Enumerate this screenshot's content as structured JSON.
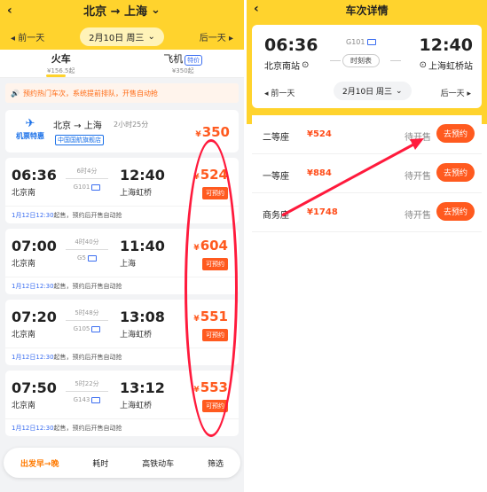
{
  "left": {
    "header": {
      "back_icon": "chevron-left-icon",
      "route": "北京 → 上海",
      "prev_day": "◂ 前一天",
      "date": "2月10日 周三",
      "next_day": "后一天 ▸"
    },
    "modes": [
      {
        "label": "火车",
        "sub": "¥156.5起"
      },
      {
        "label": "飞机",
        "sub": "¥350起",
        "badge": "特价"
      }
    ],
    "notice": "预约热门车次，系统提前排队，开售自动抢",
    "flight_card": {
      "tag": "机票特惠",
      "route": "北京 → 上海",
      "duration": "2小时25分",
      "airline": "中国国航旗舰店",
      "price": "350"
    },
    "trains": [
      {
        "dep": "06:36",
        "arr": "12:40",
        "from": "北京南",
        "to": "上海虹桥",
        "duration": "6时4分",
        "no": "G101",
        "price": "524",
        "book": "可预约",
        "sale_time": "1月12日12:30",
        "sale_text": "起售，预约后开售自动抢"
      },
      {
        "dep": "07:00",
        "arr": "11:40",
        "from": "北京南",
        "to": "上海",
        "duration": "4时40分",
        "no": "G5",
        "price": "604",
        "book": "可预约",
        "sale_time": "1月12日12:30",
        "sale_text": "起售，预约后开售自动抢"
      },
      {
        "dep": "07:20",
        "arr": "13:08",
        "from": "北京南",
        "to": "上海虹桥",
        "duration": "5时48分",
        "no": "G105",
        "price": "551",
        "book": "可预约",
        "sale_time": "1月12日12:30",
        "sale_text": "起售，预约后开售自动抢"
      },
      {
        "dep": "07:50",
        "arr": "13:12",
        "from": "北京南",
        "to": "上海虹桥",
        "duration": "5时22分",
        "no": "G143",
        "price": "553",
        "book": "可预约",
        "sale_time": "1月12日12:30",
        "sale_text": "起售，预约后开售自动抢"
      }
    ],
    "bottom_bar": [
      "出发早→晚",
      "耗时",
      "高铁动车",
      "筛选"
    ]
  },
  "right": {
    "title": "车次详情",
    "dep_time": "06:36",
    "arr_time": "12:40",
    "from": "北京南站",
    "to": "上海虹桥站",
    "train_no": "G101",
    "schedule": "时刻表",
    "prev_day": "◂ 前一天",
    "date": "2月10日 周三",
    "next_day": "后一天 ▸",
    "seats": [
      {
        "name": "二等座",
        "price": "¥524",
        "status": "待开售",
        "btn": "去预约"
      },
      {
        "name": "一等座",
        "price": "¥884",
        "status": "待开售",
        "btn": "去预约"
      },
      {
        "name": "商务座",
        "price": "¥1748",
        "status": "待开售",
        "btn": "去预约"
      }
    ]
  },
  "colors": {
    "accent_yellow": "#ffd32d",
    "price_orange": "#ff5a1f",
    "annotation_red": "#ff1a3c",
    "link_blue": "#3a6df0"
  }
}
